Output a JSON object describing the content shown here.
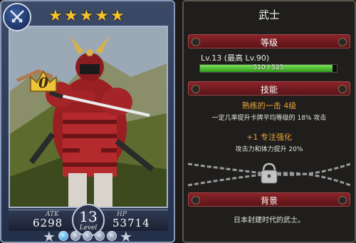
{
  "card": {
    "class_icon": "crossed-swords-icon",
    "stars": [
      "★",
      "★",
      "★",
      "★",
      "★"
    ],
    "crown_level": "0",
    "atk_label": "ATK",
    "atk_value": "6298",
    "hp_label": "HP",
    "hp_value": "53714",
    "level": "13",
    "level_word": "Level",
    "gems_total": 5,
    "gems_lit": 1
  },
  "panel": {
    "title": "武士",
    "level_section": {
      "header": "等级",
      "level_text": "Lv.13 (最高 Lv.90)",
      "exp_text": "510 / 525",
      "exp_fraction": 0.971
    },
    "skill_section": {
      "header": "技能",
      "skill_name": "熟练的一击 4级",
      "skill_desc": "一定几率提升卡牌平均等级的 18% 攻击",
      "bonus_name": "+1 专注强化",
      "bonus_desc": "攻击力和体力提升 20%"
    },
    "locked_icon": "padlock-icon",
    "background_section": {
      "header": "背景",
      "text": "日本封建时代的武士。"
    }
  },
  "colors": {
    "panel_header": "#8a2328",
    "skill_gold": "#e8a43a",
    "exp_green": "#4fc02e",
    "star_gold": "#f4c22b"
  }
}
